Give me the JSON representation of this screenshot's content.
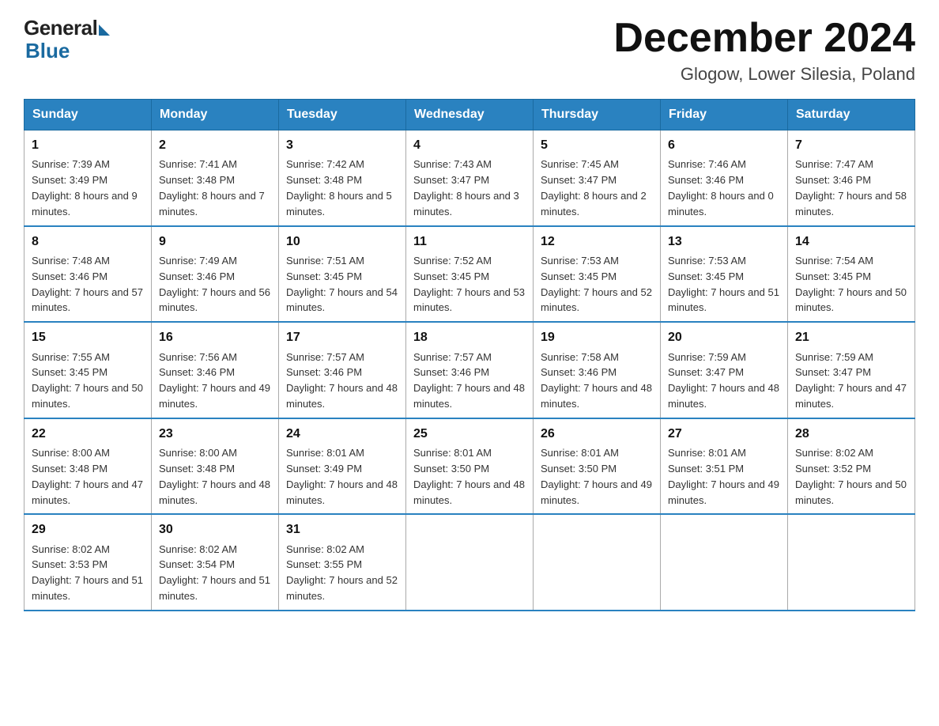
{
  "logo": {
    "general": "General",
    "blue": "Blue"
  },
  "title": "December 2024",
  "location": "Glogow, Lower Silesia, Poland",
  "days_of_week": [
    "Sunday",
    "Monday",
    "Tuesday",
    "Wednesday",
    "Thursday",
    "Friday",
    "Saturday"
  ],
  "weeks": [
    [
      {
        "day": "1",
        "sunrise": "7:39 AM",
        "sunset": "3:49 PM",
        "daylight": "8 hours and 9 minutes."
      },
      {
        "day": "2",
        "sunrise": "7:41 AM",
        "sunset": "3:48 PM",
        "daylight": "8 hours and 7 minutes."
      },
      {
        "day": "3",
        "sunrise": "7:42 AM",
        "sunset": "3:48 PM",
        "daylight": "8 hours and 5 minutes."
      },
      {
        "day": "4",
        "sunrise": "7:43 AM",
        "sunset": "3:47 PM",
        "daylight": "8 hours and 3 minutes."
      },
      {
        "day": "5",
        "sunrise": "7:45 AM",
        "sunset": "3:47 PM",
        "daylight": "8 hours and 2 minutes."
      },
      {
        "day": "6",
        "sunrise": "7:46 AM",
        "sunset": "3:46 PM",
        "daylight": "8 hours and 0 minutes."
      },
      {
        "day": "7",
        "sunrise": "7:47 AM",
        "sunset": "3:46 PM",
        "daylight": "7 hours and 58 minutes."
      }
    ],
    [
      {
        "day": "8",
        "sunrise": "7:48 AM",
        "sunset": "3:46 PM",
        "daylight": "7 hours and 57 minutes."
      },
      {
        "day": "9",
        "sunrise": "7:49 AM",
        "sunset": "3:46 PM",
        "daylight": "7 hours and 56 minutes."
      },
      {
        "day": "10",
        "sunrise": "7:51 AM",
        "sunset": "3:45 PM",
        "daylight": "7 hours and 54 minutes."
      },
      {
        "day": "11",
        "sunrise": "7:52 AM",
        "sunset": "3:45 PM",
        "daylight": "7 hours and 53 minutes."
      },
      {
        "day": "12",
        "sunrise": "7:53 AM",
        "sunset": "3:45 PM",
        "daylight": "7 hours and 52 minutes."
      },
      {
        "day": "13",
        "sunrise": "7:53 AM",
        "sunset": "3:45 PM",
        "daylight": "7 hours and 51 minutes."
      },
      {
        "day": "14",
        "sunrise": "7:54 AM",
        "sunset": "3:45 PM",
        "daylight": "7 hours and 50 minutes."
      }
    ],
    [
      {
        "day": "15",
        "sunrise": "7:55 AM",
        "sunset": "3:45 PM",
        "daylight": "7 hours and 50 minutes."
      },
      {
        "day": "16",
        "sunrise": "7:56 AM",
        "sunset": "3:46 PM",
        "daylight": "7 hours and 49 minutes."
      },
      {
        "day": "17",
        "sunrise": "7:57 AM",
        "sunset": "3:46 PM",
        "daylight": "7 hours and 48 minutes."
      },
      {
        "day": "18",
        "sunrise": "7:57 AM",
        "sunset": "3:46 PM",
        "daylight": "7 hours and 48 minutes."
      },
      {
        "day": "19",
        "sunrise": "7:58 AM",
        "sunset": "3:46 PM",
        "daylight": "7 hours and 48 minutes."
      },
      {
        "day": "20",
        "sunrise": "7:59 AM",
        "sunset": "3:47 PM",
        "daylight": "7 hours and 48 minutes."
      },
      {
        "day": "21",
        "sunrise": "7:59 AM",
        "sunset": "3:47 PM",
        "daylight": "7 hours and 47 minutes."
      }
    ],
    [
      {
        "day": "22",
        "sunrise": "8:00 AM",
        "sunset": "3:48 PM",
        "daylight": "7 hours and 47 minutes."
      },
      {
        "day": "23",
        "sunrise": "8:00 AM",
        "sunset": "3:48 PM",
        "daylight": "7 hours and 48 minutes."
      },
      {
        "day": "24",
        "sunrise": "8:01 AM",
        "sunset": "3:49 PM",
        "daylight": "7 hours and 48 minutes."
      },
      {
        "day": "25",
        "sunrise": "8:01 AM",
        "sunset": "3:50 PM",
        "daylight": "7 hours and 48 minutes."
      },
      {
        "day": "26",
        "sunrise": "8:01 AM",
        "sunset": "3:50 PM",
        "daylight": "7 hours and 49 minutes."
      },
      {
        "day": "27",
        "sunrise": "8:01 AM",
        "sunset": "3:51 PM",
        "daylight": "7 hours and 49 minutes."
      },
      {
        "day": "28",
        "sunrise": "8:02 AM",
        "sunset": "3:52 PM",
        "daylight": "7 hours and 50 minutes."
      }
    ],
    [
      {
        "day": "29",
        "sunrise": "8:02 AM",
        "sunset": "3:53 PM",
        "daylight": "7 hours and 51 minutes."
      },
      {
        "day": "30",
        "sunrise": "8:02 AM",
        "sunset": "3:54 PM",
        "daylight": "7 hours and 51 minutes."
      },
      {
        "day": "31",
        "sunrise": "8:02 AM",
        "sunset": "3:55 PM",
        "daylight": "7 hours and 52 minutes."
      },
      null,
      null,
      null,
      null
    ]
  ]
}
